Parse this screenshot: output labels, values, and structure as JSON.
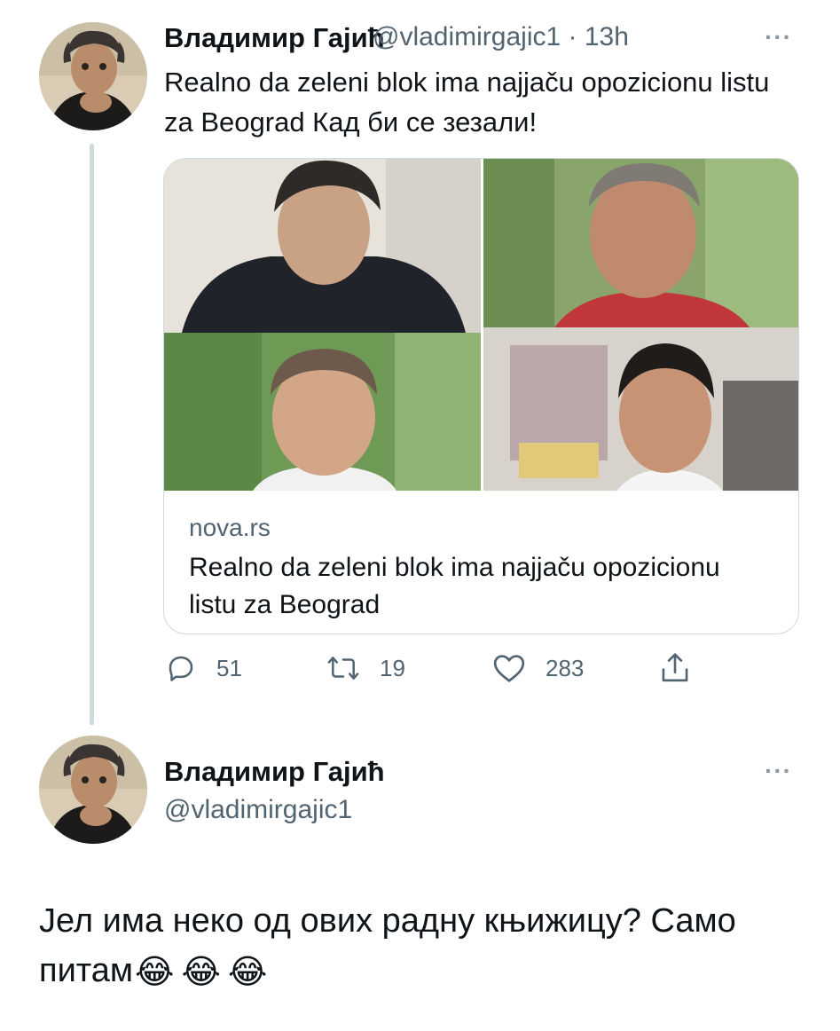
{
  "tweet": {
    "author_name": "Владимир Гајић",
    "handle_time": "@vladimirgajic1 · 13h",
    "text": "Realno da zeleni blok ima najjaču opozicionu listu za Beograd Кад би се зезали!",
    "card": {
      "domain": "nova.rs",
      "title": "Realno da zeleni blok ima najjaču opozicionu listu za Beograd"
    },
    "actions": {
      "replies": "51",
      "retweets": "19",
      "likes": "283"
    },
    "more_icon": "more-horizontal-icon"
  },
  "reply": {
    "author_name": "Владимир Гајић",
    "handle": "@vladimirgajic1",
    "text": "Јел има неко од ових радну књижицу? Само питам",
    "emoji": [
      "😂",
      "😂",
      "😂"
    ]
  },
  "colors": {
    "text": "#0f1419",
    "secondary": "#536471",
    "border": "#cfd9de"
  }
}
